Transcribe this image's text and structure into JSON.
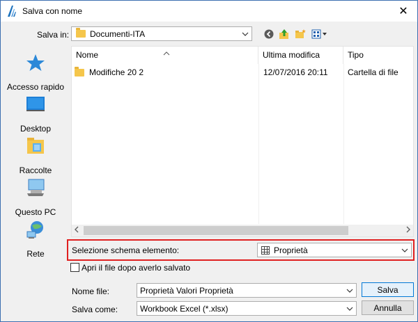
{
  "window": {
    "title": "Salva con nome",
    "close_glyph": "✕"
  },
  "save_in": {
    "label": "Salva in:",
    "value": "Documenti-ITA"
  },
  "toolbar": {
    "icons": [
      "back-icon",
      "up-folder-icon",
      "new-folder-icon",
      "view-menu-icon"
    ]
  },
  "places": [
    {
      "label": "Accesso rapido",
      "icon": "star-icon"
    },
    {
      "label": "Desktop",
      "icon": "desktop-icon"
    },
    {
      "label": "Raccolte",
      "icon": "libraries-icon"
    },
    {
      "label": "Questo PC",
      "icon": "computer-icon"
    },
    {
      "label": "Rete",
      "icon": "network-icon"
    }
  ],
  "file_list": {
    "columns": [
      "Nome",
      "Ultima modifica",
      "Tipo"
    ],
    "rows": [
      {
        "name": "Modifiche 20 2",
        "modified": "12/07/2016 20:11",
        "type": "Cartella di file"
      }
    ]
  },
  "schema": {
    "label": "Selezione schema elemento:",
    "value": "Proprietà"
  },
  "open_after_save": {
    "label": "Apri il file dopo averlo salvato",
    "checked": false
  },
  "file_name": {
    "label": "Nome file:",
    "value": "Proprietà Valori Proprietà"
  },
  "save_type": {
    "label": "Salva come:",
    "value": "Workbook Excel (*.xlsx)"
  },
  "buttons": {
    "save": "Salva",
    "cancel": "Annulla"
  },
  "colors": {
    "highlight_border": "#e02020",
    "window_border": "#3c6fb0",
    "folder": "#f5c64b"
  }
}
